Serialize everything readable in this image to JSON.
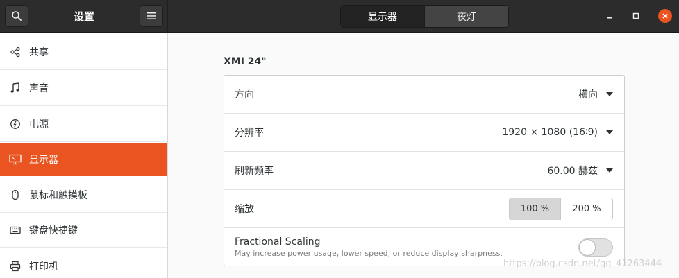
{
  "header": {
    "title": "设置",
    "tabs": [
      {
        "label": "显示器",
        "active": true
      },
      {
        "label": "夜灯",
        "active": false
      }
    ],
    "icons": {
      "search": "search-icon",
      "menu": "hamburger-menu-icon",
      "minimize": "minimize-icon",
      "maximize": "maximize-icon",
      "close": "close-icon"
    },
    "accent_color": "#e95420"
  },
  "sidebar": {
    "items": [
      {
        "label": "共享",
        "icon": "share-icon",
        "active": false
      },
      {
        "label": "声音",
        "icon": "music-note-icon",
        "active": false
      },
      {
        "label": "电源",
        "icon": "power-icon",
        "active": false
      },
      {
        "label": "显示器",
        "icon": "display-icon",
        "active": true
      },
      {
        "label": "鼠标和触摸板",
        "icon": "mouse-icon",
        "active": false
      },
      {
        "label": "键盘快捷键",
        "icon": "keyboard-icon",
        "active": false
      },
      {
        "label": "打印机",
        "icon": "printer-icon",
        "active": false
      }
    ]
  },
  "display": {
    "monitor_name": "XMI 24\"",
    "orientation": {
      "label": "方向",
      "value": "横向"
    },
    "resolution": {
      "label": "分辨率",
      "value": "1920 × 1080 (16∶9)"
    },
    "refresh_rate": {
      "label": "刷新频率",
      "value": "60.00 赫兹"
    },
    "scale": {
      "label": "缩放",
      "options": [
        "100 %",
        "200 %"
      ],
      "selected": "100 %"
    },
    "fractional_scaling": {
      "title": "Fractional Scaling",
      "description": "May increase power usage, lower speed, or reduce display sharpness.",
      "enabled": false
    }
  },
  "watermark": "https://blog.csdn.net/qq_41263444"
}
